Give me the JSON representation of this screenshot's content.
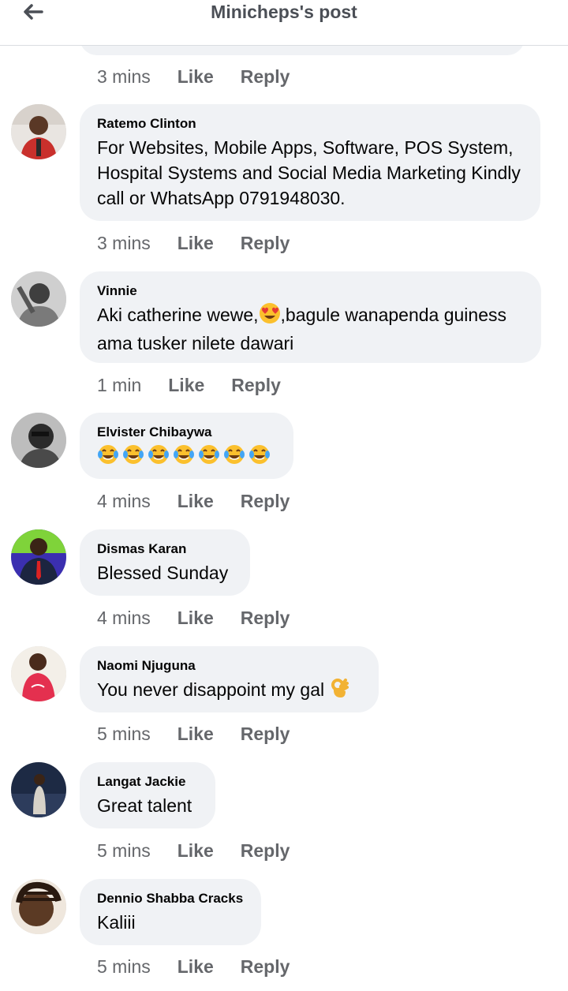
{
  "header": {
    "title": "Minicheps's post"
  },
  "actions": {
    "like": "Like",
    "reply": "Reply"
  },
  "previous_comment": {
    "time": "3 mins"
  },
  "comments": [
    {
      "author": "Ratemo Clinton",
      "text": "For Websites, Mobile Apps, Software, POS System, Hospital Systems and Social Media Marketing Kindly call or WhatsApp 0791948030.",
      "time": "3 mins"
    },
    {
      "author": "Vinnie",
      "text_before_emoji": "Aki catherine wewe,",
      "emoji": "heart-eyes-face",
      "text_after_emoji": ",bagule wanapenda guiness ama tusker nilete dawari",
      "time": "1 min"
    },
    {
      "author": "Elvister Chibaywa",
      "emojis": [
        "tears-of-joy-face",
        "tears-of-joy-face",
        "tears-of-joy-face",
        "tears-of-joy-face",
        "tears-of-joy-face",
        "tears-of-joy-face",
        "tears-of-joy-face"
      ],
      "time": "4 mins"
    },
    {
      "author": "Dismas Karan",
      "text": "Blessed Sunday",
      "time": "4 mins"
    },
    {
      "author": "Naomi Njuguna",
      "text": "You never disappoint my gal",
      "emoji": "ok-hand",
      "time": "5 mins"
    },
    {
      "author": "Langat Jackie",
      "text": "Great talent",
      "time": "5 mins"
    },
    {
      "author": "Dennio Shabba Cracks",
      "text": "Kaliii",
      "time": "5 mins"
    }
  ],
  "colors": {
    "bubble": "#f0f2f5",
    "meta_text": "#65676b",
    "header_text": "#4b4f56"
  }
}
